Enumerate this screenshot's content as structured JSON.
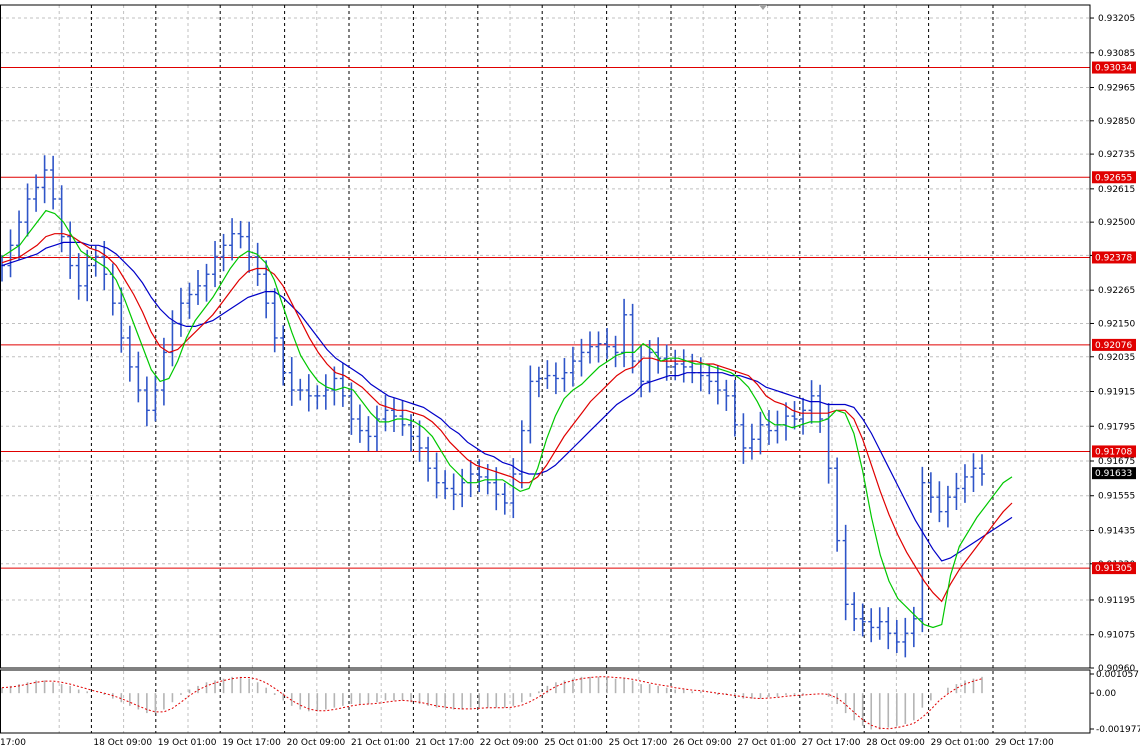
{
  "colors": {
    "background": "#ffffff",
    "grid": "#c0c0c0",
    "session_line": "#000000",
    "bar": "#2f55c8",
    "ma_fast": "#00c800",
    "ma_mid": "#e00000",
    "ma_slow": "#0000c8",
    "level_line": "#e00000",
    "level_tag_bg": "#e00000",
    "current_tag_bg": "#000000",
    "osc_bar": "#b4b4b4",
    "osc_line": "#e00000"
  },
  "chart_data": {
    "type": "line",
    "price_axis": {
      "range": [
        0.9096,
        0.9325
      ],
      "ticks": [
        "0.93205",
        "0.93085",
        "0.92965",
        "0.92850",
        "0.92735",
        "0.92615",
        "0.92500",
        "0.92385",
        "0.92265",
        "0.92150",
        "0.92035",
        "0.91915",
        "0.91795",
        "0.91675",
        "0.91555",
        "0.91435",
        "0.91320",
        "0.91195",
        "0.91075",
        "0.90960"
      ]
    },
    "levels": [
      {
        "label": "0.93034",
        "value": 0.93034
      },
      {
        "label": "0.92655",
        "value": 0.92655
      },
      {
        "label": "0.92378",
        "value": 0.92378
      },
      {
        "label": "0.92076",
        "value": 0.92076
      },
      {
        "label": "0.91708",
        "value": 0.91708
      },
      {
        "label": "0.91305",
        "value": 0.91305
      }
    ],
    "current_price": {
      "label": "0.91633",
      "value": 0.91633
    },
    "time_axis": {
      "labels": [
        "17:00",
        "18 Oct 09:00",
        "19 Oct 01:00",
        "19 Oct 17:00",
        "20 Oct 09:00",
        "21 Oct 01:00",
        "21 Oct 17:00",
        "22 Oct 09:00",
        "25 Oct 01:00",
        "25 Oct 17:00",
        "26 Oct 09:00",
        "27 Oct 01:00",
        "27 Oct 17:00",
        "28 Oct 09:00",
        "29 Oct 01:00",
        "29 Oct 17:00"
      ]
    },
    "close_series": [
      0.9235,
      0.9242,
      0.925,
      0.9258,
      0.9262,
      0.9268,
      0.9258,
      0.9245,
      0.9235,
      0.9228,
      0.9235,
      0.9238,
      0.9232,
      0.9222,
      0.921,
      0.92,
      0.9192,
      0.9185,
      0.9192,
      0.9205,
      0.9215,
      0.9222,
      0.9225,
      0.9228,
      0.9232,
      0.9238,
      0.9242,
      0.9246,
      0.9245,
      0.9238,
      0.9232,
      0.9222,
      0.921,
      0.9198,
      0.9192,
      0.9192,
      0.919,
      0.919,
      0.9192,
      0.9196,
      0.919,
      0.9182,
      0.9178,
      0.9176,
      0.9182,
      0.9185,
      0.9183,
      0.918,
      0.9176,
      0.9172,
      0.9165,
      0.916,
      0.9158,
      0.9156,
      0.916,
      0.9163,
      0.9162,
      0.916,
      0.9156,
      0.9153,
      0.9163,
      0.9178,
      0.9195,
      0.9196,
      0.9197,
      0.9196,
      0.9198,
      0.9202,
      0.9205,
      0.9207,
      0.9208,
      0.9207,
      0.9205,
      0.9218,
      0.9202,
      0.9195,
      0.9205,
      0.9203,
      0.92,
      0.9201,
      0.92,
      0.9198,
      0.9197,
      0.9195,
      0.9192,
      0.919,
      0.918,
      0.9172,
      0.9175,
      0.918,
      0.9178,
      0.918,
      0.9183,
      0.9182,
      0.9185,
      0.919,
      0.9182,
      0.9165,
      0.914,
      0.9118,
      0.9113,
      0.9112,
      0.911,
      0.9112,
      0.9108,
      0.9105,
      0.9108,
      0.9113,
      0.916,
      0.9155,
      0.915,
      0.9155,
      0.9158,
      0.9162,
      0.9165,
      0.9163
    ],
    "ma_fast_series": [
      0.9238,
      0.924,
      0.9242,
      0.9246,
      0.925,
      0.9254,
      0.9253,
      0.925,
      0.9245,
      0.924,
      0.9238,
      0.9236,
      0.9234,
      0.923,
      0.9223,
      0.9215,
      0.9207,
      0.9199,
      0.9195,
      0.9196,
      0.9202,
      0.921,
      0.9216,
      0.922,
      0.9224,
      0.9229,
      0.9234,
      0.9238,
      0.924,
      0.9239,
      0.9236,
      0.923,
      0.9221,
      0.9212,
      0.9204,
      0.9199,
      0.9195,
      0.9193,
      0.9192,
      0.9193,
      0.9192,
      0.9188,
      0.9184,
      0.9181,
      0.9181,
      0.9182,
      0.9182,
      0.9181,
      0.9179,
      0.9176,
      0.9171,
      0.9166,
      0.9163,
      0.916,
      0.916,
      0.9161,
      0.9161,
      0.9161,
      0.9159,
      0.9157,
      0.9158,
      0.9165,
      0.9175,
      0.9183,
      0.9189,
      0.9192,
      0.9194,
      0.9197,
      0.92,
      0.9202,
      0.9204,
      0.9205,
      0.9205,
      0.9208,
      0.9206,
      0.9202,
      0.9203,
      0.9203,
      0.9202,
      0.9201,
      0.9201,
      0.92,
      0.9199,
      0.9198,
      0.9196,
      0.9193,
      0.9188,
      0.9182,
      0.918,
      0.918,
      0.9179,
      0.918,
      0.9181,
      0.9181,
      0.9182,
      0.9185,
      0.9184,
      0.9177,
      0.9164,
      0.9148,
      0.9135,
      0.9126,
      0.912,
      0.9117,
      0.9114,
      0.9111,
      0.911,
      0.9111,
      0.9128,
      0.9138,
      0.9143,
      0.9148,
      0.9152,
      0.9156,
      0.916,
      0.9162
    ],
    "ma_mid_series": [
      0.9236,
      0.9237,
      0.9238,
      0.924,
      0.9242,
      0.9245,
      0.9246,
      0.9246,
      0.9245,
      0.9243,
      0.9241,
      0.924,
      0.9238,
      0.9235,
      0.923,
      0.9225,
      0.9219,
      0.9212,
      0.9207,
      0.9205,
      0.9206,
      0.9209,
      0.9212,
      0.9215,
      0.9218,
      0.9222,
      0.9226,
      0.923,
      0.9233,
      0.9234,
      0.9234,
      0.9232,
      0.9228,
      0.9222,
      0.9216,
      0.921,
      0.9205,
      0.9201,
      0.9198,
      0.9197,
      0.9195,
      0.9193,
      0.919,
      0.9187,
      0.9186,
      0.9185,
      0.9185,
      0.9184,
      0.9183,
      0.9181,
      0.9178,
      0.9174,
      0.9171,
      0.9168,
      0.9166,
      0.9165,
      0.9164,
      0.9163,
      0.9162,
      0.916,
      0.916,
      0.9162,
      0.9166,
      0.9171,
      0.9176,
      0.918,
      0.9184,
      0.9188,
      0.9191,
      0.9194,
      0.9197,
      0.9199,
      0.92,
      0.9203,
      0.9203,
      0.9202,
      0.9202,
      0.9202,
      0.9202,
      0.9202,
      0.9201,
      0.9201,
      0.92,
      0.9199,
      0.9198,
      0.9197,
      0.9194,
      0.919,
      0.9188,
      0.9187,
      0.9185,
      0.9184,
      0.9184,
      0.9184,
      0.9184,
      0.9185,
      0.9185,
      0.9182,
      0.9175,
      0.9166,
      0.9157,
      0.9149,
      0.9142,
      0.9136,
      0.9131,
      0.9126,
      0.9122,
      0.9119,
      0.9125,
      0.913,
      0.9134,
      0.9138,
      0.9142,
      0.9146,
      0.915,
      0.9153
    ],
    "ma_slow_series": [
      0.9235,
      0.9236,
      0.9237,
      0.9238,
      0.9239,
      0.9241,
      0.9242,
      0.9243,
      0.9243,
      0.9243,
      0.9242,
      0.9242,
      0.9241,
      0.9239,
      0.9236,
      0.9233,
      0.9229,
      0.9224,
      0.922,
      0.9217,
      0.9215,
      0.9214,
      0.9214,
      0.9215,
      0.9216,
      0.9218,
      0.922,
      0.9222,
      0.9224,
      0.9225,
      0.9226,
      0.9226,
      0.9224,
      0.9221,
      0.9218,
      0.9214,
      0.921,
      0.9206,
      0.9203,
      0.9201,
      0.9199,
      0.9197,
      0.9194,
      0.9192,
      0.919,
      0.9189,
      0.9188,
      0.9187,
      0.9186,
      0.9184,
      0.9182,
      0.9179,
      0.9177,
      0.9174,
      0.9172,
      0.917,
      0.9169,
      0.9167,
      0.9166,
      0.9164,
      0.9163,
      0.9163,
      0.9164,
      0.9166,
      0.9169,
      0.9172,
      0.9175,
      0.9178,
      0.9181,
      0.9184,
      0.9187,
      0.9189,
      0.9191,
      0.9194,
      0.9195,
      0.9196,
      0.9197,
      0.9197,
      0.9198,
      0.9198,
      0.9198,
      0.9198,
      0.9198,
      0.9197,
      0.9197,
      0.9196,
      0.9195,
      0.9193,
      0.9192,
      0.9191,
      0.919,
      0.9189,
      0.9188,
      0.9188,
      0.9187,
      0.9187,
      0.9187,
      0.9186,
      0.9182,
      0.9177,
      0.9171,
      0.9165,
      0.9159,
      0.9153,
      0.9147,
      0.9142,
      0.9137,
      0.9133,
      0.9134,
      0.9136,
      0.9138,
      0.914,
      0.9142,
      0.9144,
      0.9146,
      0.9148
    ],
    "oscillator": {
      "range": [
        -0.001977,
        0.001057
      ],
      "ticks": [
        "0.001057",
        "0.00",
        "-0.001977"
      ],
      "values": [
        0.0003,
        0.0004,
        0.0005,
        0.0006,
        0.0007,
        0.0007,
        0.0006,
        0.0005,
        0.0004,
        0.0002,
        0.0001,
        0.0,
        -0.0001,
        -0.0003,
        -0.0005,
        -0.0007,
        -0.0009,
        -0.0011,
        -0.0011,
        -0.0009,
        -0.0005,
        -0.0001,
        0.0002,
        0.0004,
        0.0006,
        0.0007,
        0.0008,
        0.0009,
        0.0009,
        0.0008,
        0.0006,
        0.0003,
        -0.0001,
        -0.0004,
        -0.0007,
        -0.0009,
        -0.001,
        -0.001,
        -0.0009,
        -0.0008,
        -0.0007,
        -0.0006,
        -0.0006,
        -0.0006,
        -0.0005,
        -0.0004,
        -0.0004,
        -0.0004,
        -0.0005,
        -0.0006,
        -0.0007,
        -0.0008,
        -0.0008,
        -0.0009,
        -0.0009,
        -0.0008,
        -0.0008,
        -0.0008,
        -0.0008,
        -0.0008,
        -0.0007,
        -0.0005,
        -0.0002,
        0.0001,
        0.0004,
        0.0006,
        0.0007,
        0.0008,
        0.0009,
        0.0009,
        0.0009,
        0.0009,
        0.0008,
        0.0008,
        0.0007,
        0.0005,
        0.0005,
        0.0004,
        0.0003,
        0.0002,
        0.0002,
        0.0001,
        0.0001,
        0.0,
        -0.0001,
        -0.0001,
        -0.0002,
        -0.0003,
        -0.0003,
        -0.0003,
        -0.0002,
        -0.0002,
        -0.0001,
        -0.0001,
        -0.0001,
        0.0,
        0.0,
        -0.0002,
        -0.0006,
        -0.0011,
        -0.0015,
        -0.0018,
        -0.002,
        -0.002,
        -0.0019,
        -0.0018,
        -0.0017,
        -0.0015,
        -0.0008,
        -0.0004,
        0.0,
        0.0003,
        0.0005,
        0.0007,
        0.0008,
        0.0009
      ]
    }
  }
}
